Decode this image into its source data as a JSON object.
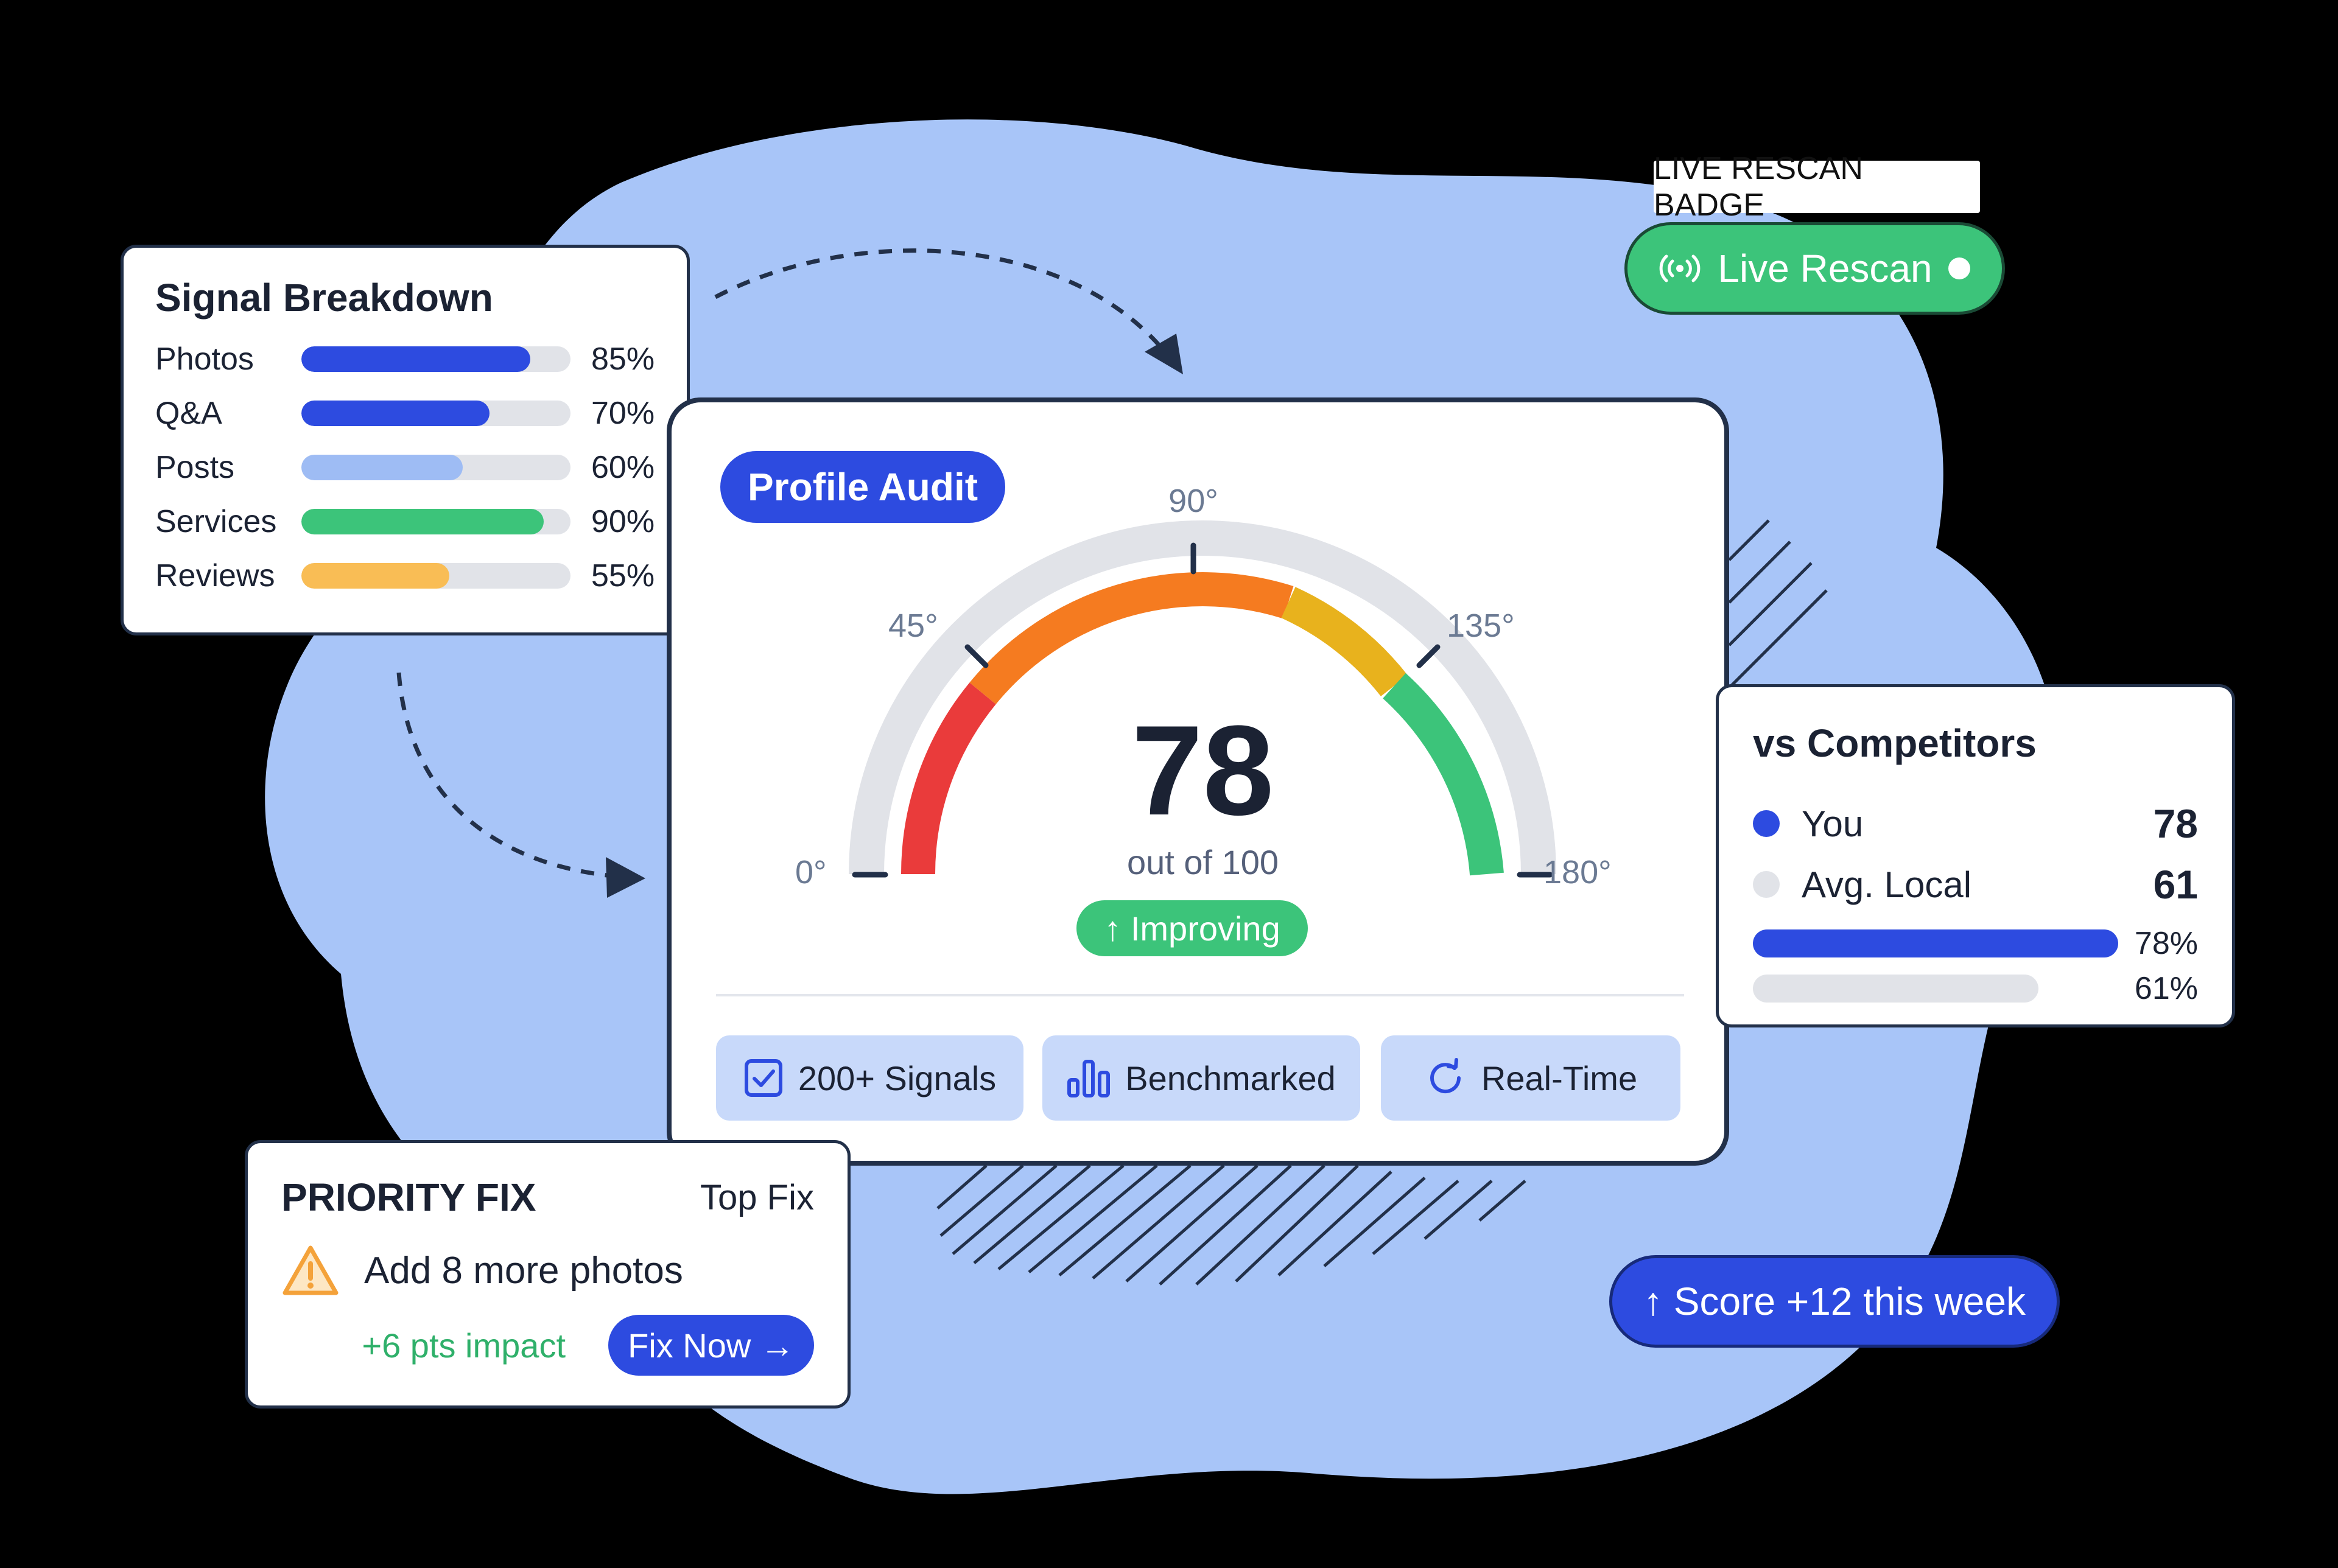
{
  "colors": {
    "background": "#000000",
    "blob": "#a8c5f8",
    "primary": "#2d4be0",
    "light_blue": "#9ebcf4",
    "green": "#3cc47a",
    "orange": "#f9bd55",
    "track": "#e1e3e8",
    "card_border": "#223049",
    "gauge_red": "#ea3b3b",
    "gauge_orange": "#f57b20",
    "gauge_yellow": "#e8b21d"
  },
  "signal_breakdown": {
    "title": "Signal Breakdown",
    "items": [
      {
        "label": "Photos",
        "value": "85%",
        "fraction": 0.85,
        "color": "#2d4be0"
      },
      {
        "label": "Q&A",
        "value": "70%",
        "fraction": 0.7,
        "color": "#2d4be0"
      },
      {
        "label": "Posts",
        "value": "60%",
        "fraction": 0.6,
        "color": "#9ebcf4"
      },
      {
        "label": "Services",
        "value": "90%",
        "fraction": 0.9,
        "color": "#3cc47a"
      },
      {
        "label": "Reviews",
        "value": "55%",
        "fraction": 0.55,
        "color": "#f9bd55"
      }
    ]
  },
  "audit": {
    "pill": "Profile Audit",
    "score": "78",
    "score_fraction": 0.78,
    "out_of": "out of 100",
    "trend": "↑ Improving",
    "gauge_labels": [
      "0°",
      "45°",
      "90°",
      "135°",
      "180°"
    ],
    "features": [
      {
        "label": "200+ Signals",
        "icon": "checkbox-icon"
      },
      {
        "label": "Benchmarked",
        "icon": "bar-chart-icon"
      },
      {
        "label": "Real-Time",
        "icon": "refresh-icon"
      }
    ]
  },
  "live_badge": {
    "caption": "LIVE RESCAN BADGE",
    "label": "Live Rescan",
    "icon": "broadcast-icon"
  },
  "competitors": {
    "title": "vs Competitors",
    "rows": [
      {
        "name": "You",
        "value": "78",
        "dot_color": "#2d4be0"
      },
      {
        "name": "Avg. Local",
        "value": "61",
        "dot_color": "#e1e3e8"
      }
    ],
    "bars": [
      {
        "label": "78%",
        "fraction": 0.78,
        "color": "#2d4be0"
      },
      {
        "label": "61%",
        "fraction": 0.61,
        "color": "#e1e3e8"
      }
    ]
  },
  "priority_fix": {
    "title": "PRIORITY FIX",
    "tag": "Top Fix",
    "task": "Add 8 more photos",
    "impact": "+6 pts impact",
    "button": "Fix Now →",
    "icon": "warning-icon"
  },
  "score_change": {
    "label": "↑ Score +12 this week"
  }
}
